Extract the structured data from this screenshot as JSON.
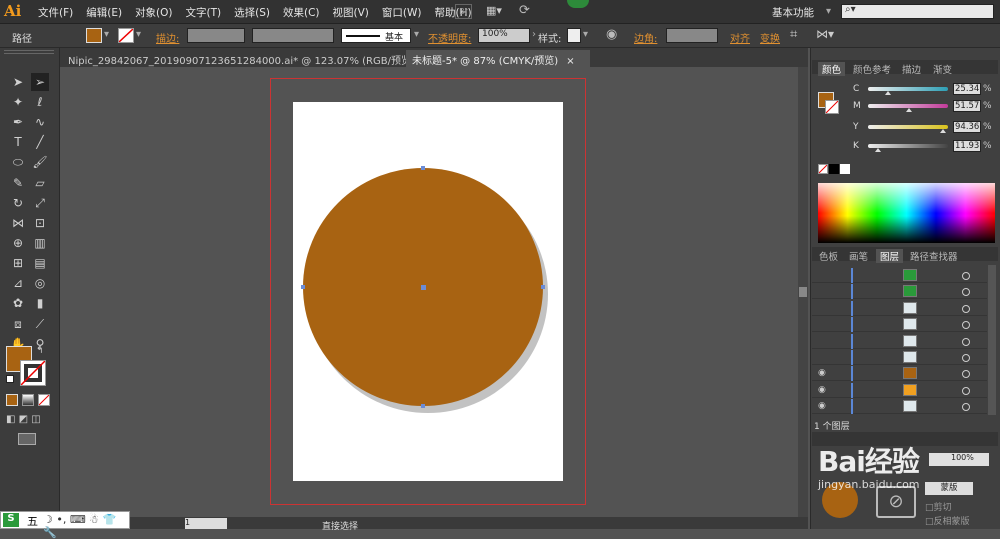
{
  "app": {
    "logo": "Ai",
    "workspace": "基本功能",
    "colors": {
      "fill": "#A86312",
      "accent": "#E09030"
    }
  },
  "menus": [
    "文件(F)",
    "编辑(E)",
    "对象(O)",
    "文字(T)",
    "选择(S)",
    "效果(C)",
    "视图(V)",
    "窗口(W)",
    "帮助(H)"
  ],
  "br": "Br",
  "control": {
    "type": "路径",
    "stroke_label": "描边:",
    "profile": "基本",
    "opacity_label": "不透明度:",
    "opacity_value": "100%",
    "style_label": "样式:",
    "corner_label": "边角:",
    "align": "对齐",
    "transform": "变换"
  },
  "tabs": [
    {
      "label": "Nipic_29842067_20190907123651284000.ai* @ 123.07% (RGB/预览)",
      "close": "×"
    },
    {
      "label": "未标题-5* @ 87% (CMYK/预览)",
      "close": "×"
    }
  ],
  "tools": [
    "pointer-arrow-icon",
    "direct-select-icon",
    "magic-wand-icon",
    "lasso-icon",
    "pen-icon",
    "curvature-icon",
    "type-icon",
    "line-icon",
    "ellipse-icon",
    "paintbrush-icon",
    "pencil-icon",
    "eraser-icon",
    "rotate-icon",
    "scale-icon",
    "width-icon",
    "free-transform-icon",
    "shape-builder-icon",
    "perspective-icon",
    "mesh-icon",
    "gradient-icon",
    "eyedropper-icon",
    "blend-icon",
    "symbol-sprayer-icon",
    "column-graph-icon",
    "artboard-icon",
    "slice-icon",
    "hand-icon",
    "zoom-icon"
  ],
  "color_panel": {
    "tabs": [
      "颜色",
      "颜色参考",
      "描边",
      "渐变"
    ],
    "channels": [
      {
        "label": "C",
        "value": "25.34",
        "unit": "%",
        "color": "#2d9fb5"
      },
      {
        "label": "M",
        "value": "51.57",
        "unit": "%",
        "color": "#c23b9a"
      },
      {
        "label": "Y",
        "value": "94.36",
        "unit": "%",
        "color": "#d9c21c"
      },
      {
        "label": "K",
        "value": "11.93",
        "unit": "%",
        "color": "#444444"
      }
    ]
  },
  "layers_panel": {
    "tabs": [
      "色板",
      "画笔",
      "图层",
      "路径查找器"
    ],
    "count": "1 个图层",
    "rows": [
      {
        "visible": false,
        "thumb": "#2a9a3a"
      },
      {
        "visible": false,
        "thumb": "#2a9a3a"
      },
      {
        "visible": false,
        "thumb": "#dfe8ec"
      },
      {
        "visible": false,
        "thumb": "#dfe8ec"
      },
      {
        "visible": false,
        "thumb": "#dfe8ec"
      },
      {
        "visible": false,
        "thumb": "#dfe8ec"
      },
      {
        "visible": true,
        "thumb": "#a86312"
      },
      {
        "visible": true,
        "thumb": "#f0a020"
      },
      {
        "visible": true,
        "thumb": "#dfe8ec"
      }
    ]
  },
  "transparency": {
    "opacity": "100%",
    "mask_button": "蒙版",
    "clip": "剪切",
    "invert_mask": "反相蒙版"
  },
  "status": {
    "zoom": "1",
    "tool": "直接选择"
  },
  "taskbar": {
    "ime": "五"
  },
  "watermark": "Bai经验",
  "watermark_url": "jingyan.baidu.com"
}
